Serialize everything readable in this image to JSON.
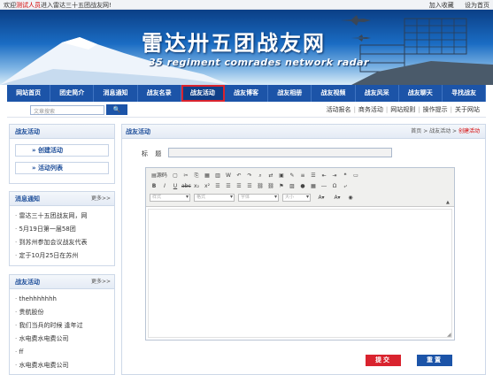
{
  "topbar": {
    "welcome_prefix": "欢迎",
    "welcome_user": "测试人员",
    "welcome_suffix": "进入雷达三十五团战友网!",
    "favorite": "加入收藏",
    "homepage": "设为首页"
  },
  "banner": {
    "title": "雷达卅五团战友网",
    "subtitle": "35 regiment comrades network radar"
  },
  "nav": [
    "网站首页",
    "团史简介",
    "消息通知",
    "战友名录",
    "战友活动",
    "战友博客",
    "战友相册",
    "战友视频",
    "战友风采",
    "战友聊天",
    "寻找战友"
  ],
  "nav_active": 4,
  "search": {
    "placeholder": "文章搜索"
  },
  "sublinks": [
    "活动报名",
    "商务活动",
    "网站规则",
    "操作提示",
    "关于网站"
  ],
  "sidebar": {
    "activity_box": {
      "title": "战友活动",
      "create": "创建活动",
      "list": "活动列表"
    },
    "news": {
      "title": "消息通知",
      "more": "更多>>",
      "items": [
        "雷达三十五团战友网，网",
        "5月19日第一届58团",
        "到苏州参加会议战友代表",
        "定于10月25日在苏州"
      ]
    },
    "activities": {
      "title": "战友活动",
      "more": "更多>>",
      "items": [
        "thehhhhhhh",
        "贵航股份",
        "我们当兵的时候  逢年过",
        "水电费水电费公司",
        "ff",
        "水电费水电费公司"
      ]
    }
  },
  "main": {
    "title": "战友活动",
    "breadcrumb": {
      "home": "首页",
      "section": "战友活动",
      "current": "创建活动"
    },
    "title_label": "标  题",
    "editor": {
      "source": "源码",
      "style_placeholder": "样式",
      "format_placeholder": "格式",
      "font_placeholder": "字体",
      "size_placeholder": "大小"
    },
    "submit": "提交",
    "reset": "重置"
  }
}
